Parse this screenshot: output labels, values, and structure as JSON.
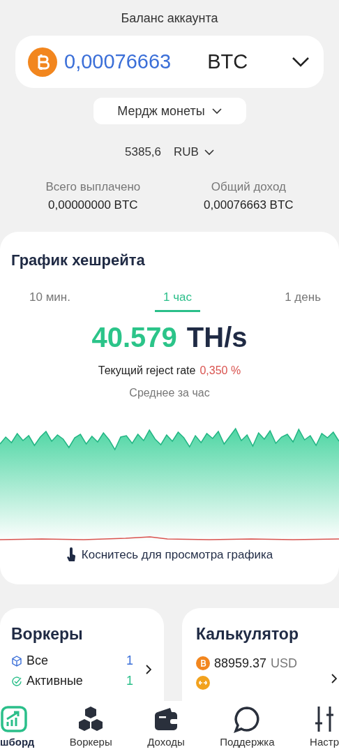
{
  "balance": {
    "title": "Баланс аккаунта",
    "amount": "0,00076663",
    "currency": "BTC"
  },
  "merge_button": {
    "label": "Мердж монеты"
  },
  "fiat": {
    "amount": "5385,6",
    "currency": "RUB"
  },
  "stats": [
    {
      "label": "Всего выплачено",
      "value": "0,00000000 BTC"
    },
    {
      "label": "Общий доход",
      "value": "0,00076663 BTC"
    }
  ],
  "hashrate": {
    "title": "График хешрейта",
    "tabs": [
      {
        "label": "10 мин.",
        "selected": false
      },
      {
        "label": "1 час",
        "selected": true
      },
      {
        "label": "1 день",
        "selected": false
      }
    ],
    "value": "40.579",
    "unit": "TH/s",
    "reject_label": "Текущий reject rate",
    "reject_value": "0,350 %",
    "period": "Среднее за час",
    "hint": "Коснитесь для просмотра графика"
  },
  "workers": {
    "title": "Воркеры",
    "rows": [
      {
        "kind": "all",
        "label": "Все",
        "count": "1"
      },
      {
        "kind": "active",
        "label": "Активные",
        "count": "1"
      }
    ]
  },
  "calculator": {
    "title": "Калькулятор",
    "price": "88959.37",
    "currency": "USD"
  },
  "nav": [
    {
      "kind": "dashboard",
      "label": "шборд",
      "selected": true
    },
    {
      "kind": "workers",
      "label": "Воркеры",
      "selected": false
    },
    {
      "kind": "income",
      "label": "Доходы",
      "selected": false
    },
    {
      "kind": "support",
      "label": "Поддержка",
      "selected": false
    },
    {
      "kind": "settings",
      "label": "Настр",
      "selected": false
    }
  ]
}
